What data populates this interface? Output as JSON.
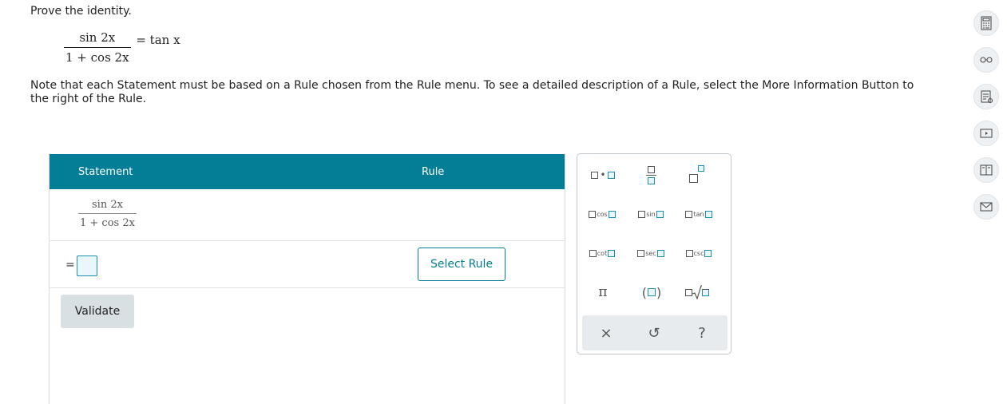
{
  "prompt": "Prove the identity.",
  "identity": {
    "numerator": "sin 2x",
    "denominator": "1 + cos 2x",
    "rhs": "= tan x"
  },
  "note": "Note that each Statement must be based on a Rule chosen from the Rule menu. To see a detailed description of a Rule, select the More Information Button to the right of the Rule.",
  "table": {
    "headers": {
      "statement": "Statement",
      "rule": "Rule"
    },
    "row1": {
      "numerator": "sin 2x",
      "denominator": "1 + cos 2x"
    },
    "row2": {
      "eq": "=",
      "select_rule": "Select Rule"
    },
    "validate": "Validate"
  },
  "palette": {
    "trig": [
      "cos",
      "sin",
      "tan",
      "cot",
      "sec",
      "csc"
    ],
    "pi": "π",
    "clear": "×",
    "undo": "↺",
    "help": "?"
  },
  "rail_icons": [
    "calculator-icon",
    "glasses-icon",
    "notes-icon",
    "video-icon",
    "textbook-icon",
    "mail-icon"
  ],
  "colors": {
    "header": "#047d96",
    "accent": "#1b8fb4",
    "validate_bg": "#d9e0e4"
  }
}
